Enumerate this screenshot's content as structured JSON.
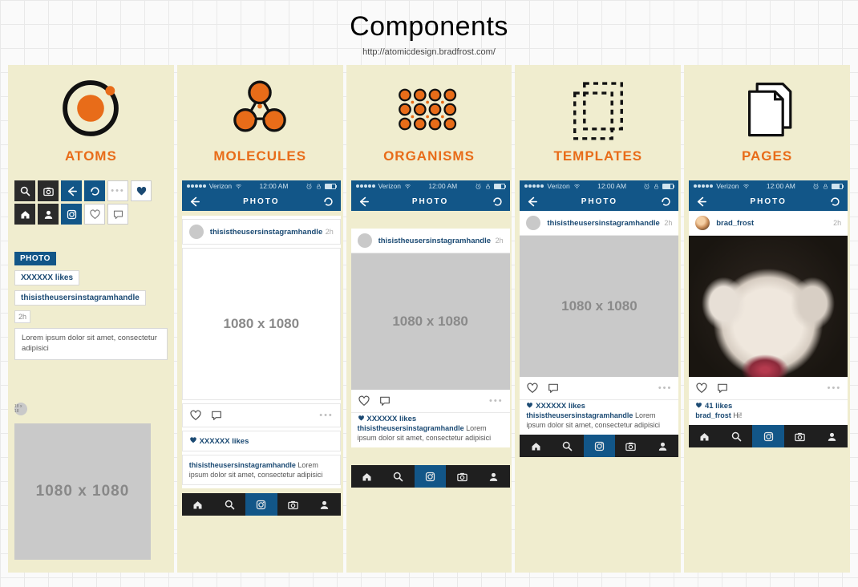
{
  "page": {
    "title": "Components",
    "reference": "http://atomicdesign.bradfrost.com/"
  },
  "columns": [
    {
      "key": "atoms",
      "title": "ATOMS"
    },
    {
      "key": "molecules",
      "title": "MOLECULES"
    },
    {
      "key": "organisms",
      "title": "ORGANISMS"
    },
    {
      "key": "templates",
      "title": "TEMPLATES"
    },
    {
      "key": "pages",
      "title": "PAGES"
    }
  ],
  "atoms": {
    "photo_label": "PHOTO",
    "likes": "XXXXXX likes",
    "handle": "thisistheusersinstagramhandle",
    "time": "2h",
    "lorem": "Lorem ipsum dolor sit amet, consectetur adipisici",
    "avatar_dim": "18 x 18",
    "image_dim": "1080 x 1080"
  },
  "phone": {
    "carrier": "Verizon",
    "clock": "12:00 AM",
    "nav_title": "PHOTO",
    "placeholder_user": "thisistheusersinstagramhandle",
    "placeholder_time": "2h",
    "placeholder_likes": "XXXXXX likes",
    "placeholder_caption_prefix": "thisistheusersinstagramhandle",
    "placeholder_caption_body": "Lorem ipsum dolor sit amet, consectetur adipisici",
    "image_dim": "1080 x 1080"
  },
  "pages": {
    "user": "brad_frost",
    "time": "2h",
    "likes": "41 likes",
    "comment_user": "brad_frost",
    "comment_text": "Hi!"
  }
}
